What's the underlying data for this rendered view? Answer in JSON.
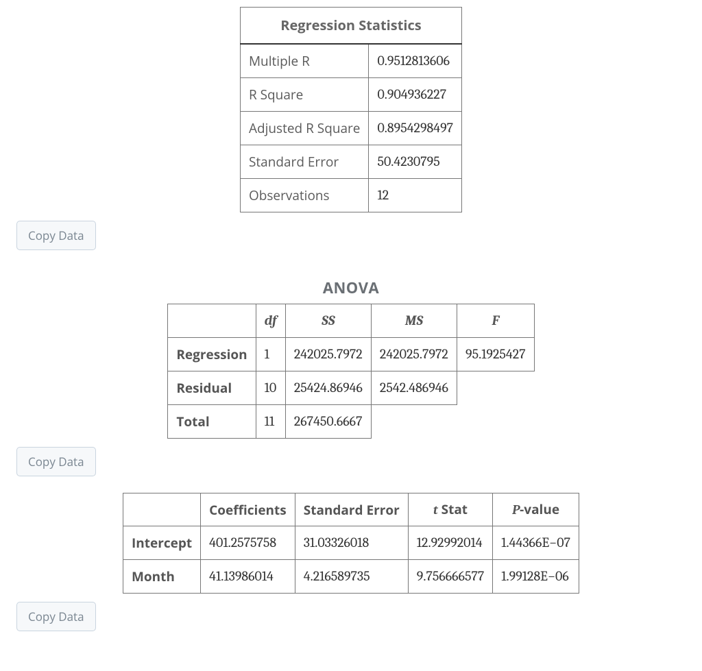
{
  "copy_label": "Copy Data",
  "reg_stats": {
    "title": "Regression Statistics",
    "rows": [
      {
        "label": "Multiple R",
        "value": "0.9512813606"
      },
      {
        "label": "R Square",
        "value": "0.904936227"
      },
      {
        "label": "Adjusted R Square",
        "value": "0.8954298497"
      },
      {
        "label": "Standard Error",
        "value": "50.4230795"
      },
      {
        "label": "Observations",
        "value": "12"
      }
    ]
  },
  "anova": {
    "title": "ANOVA",
    "headers": {
      "df": "df",
      "ss": "SS",
      "ms": "MS",
      "f": "F"
    },
    "rows": [
      {
        "label": "Regression",
        "df": "1",
        "ss": "242025.7972",
        "ms": "242025.7972",
        "f": "95.1925427"
      },
      {
        "label": "Residual",
        "df": "10",
        "ss": "25424.86946",
        "ms": "2542.486946",
        "f": ""
      },
      {
        "label": "Total",
        "df": "11",
        "ss": "267450.6667",
        "ms": "",
        "f": ""
      }
    ]
  },
  "coefficients": {
    "headers": {
      "coef": "Coefficients",
      "stderr": "Standard Error",
      "tstat_t": "t",
      "tstat_rest": " Stat",
      "pval_P": "P",
      "pval_rest": "-value"
    },
    "rows": [
      {
        "label": "Intercept",
        "coef": "401.2575758",
        "stderr": "31.03326018",
        "tstat": "12.92992014",
        "p_mant": "1.44366",
        "p_e": "E",
        "p_exp": "−07"
      },
      {
        "label": "Month",
        "coef": "41.13986014",
        "stderr": "4.216589735",
        "tstat": "9.756666577",
        "p_mant": "1.99128",
        "p_e": "E",
        "p_exp": "−06"
      }
    ]
  },
  "chart_data": [
    {
      "type": "table",
      "title": "Regression Statistics",
      "rows": {
        "Multiple R": 0.9512813606,
        "R Square": 0.904936227,
        "Adjusted R Square": 0.8954298497,
        "Standard Error": 50.4230795,
        "Observations": 12
      }
    },
    {
      "type": "table",
      "title": "ANOVA",
      "columns": [
        "",
        "df",
        "SS",
        "MS",
        "F"
      ],
      "rows": [
        [
          "Regression",
          1,
          242025.7972,
          242025.7972,
          95.1925427
        ],
        [
          "Residual",
          10,
          25424.86946,
          2542.486946,
          null
        ],
        [
          "Total",
          11,
          267450.6667,
          null,
          null
        ]
      ]
    },
    {
      "type": "table",
      "title": "Coefficients",
      "columns": [
        "",
        "Coefficients",
        "Standard Error",
        "t Stat",
        "P-value"
      ],
      "rows": [
        [
          "Intercept",
          401.2575758,
          31.03326018,
          12.92992014,
          1.44366e-07
        ],
        [
          "Month",
          41.13986014,
          4.216589735,
          9.756666577,
          1.99128e-06
        ]
      ]
    }
  ]
}
